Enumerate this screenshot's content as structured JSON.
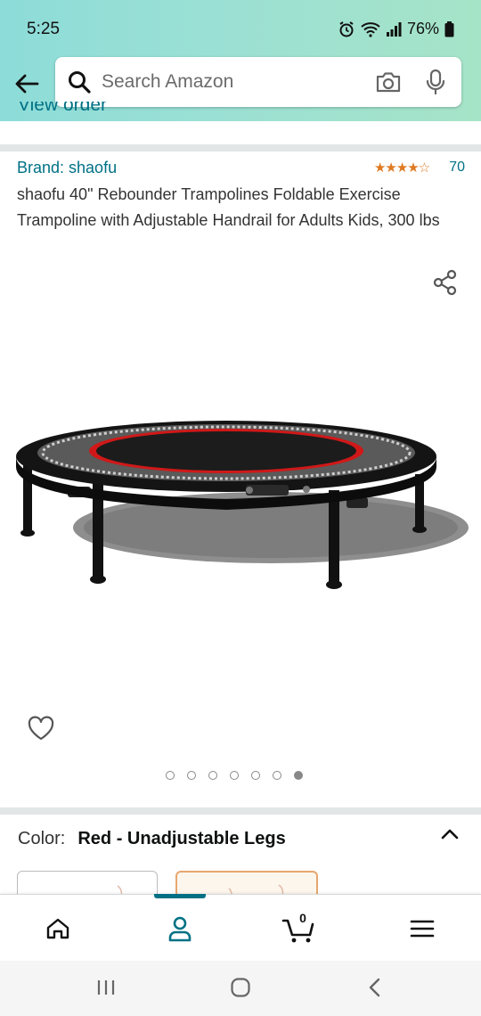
{
  "status_bar": {
    "time": "5:25",
    "battery": "76%"
  },
  "search": {
    "placeholder": "Search Amazon"
  },
  "previous_section": {
    "link_text": "View order"
  },
  "product": {
    "brand_link": "Brand: shaofu",
    "rating_stars": "★★★★☆",
    "rating_value": 4.5,
    "rating_count": "70",
    "title": "shaofu 40\" Rebounder Trampolines Foldable Exercise Trampoline with Adjustable Handrail for Adults Kids, 300 lbs",
    "image_count": 7,
    "active_image_index": 6
  },
  "color_selector": {
    "label": "Color:",
    "value": "Red - Unadjustable Legs"
  },
  "bottom_nav": {
    "items": [
      "home",
      "account",
      "cart",
      "menu"
    ],
    "active": "account",
    "cart_count": "0"
  },
  "colors": {
    "link": "#007185",
    "star": "#de7921",
    "accent_swatch_border": "#e7a66f"
  }
}
